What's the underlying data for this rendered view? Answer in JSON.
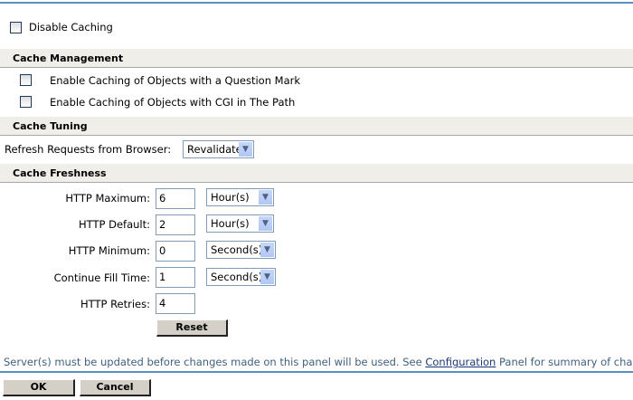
{
  "disable_caching": {
    "label": "Disable Caching",
    "checked": false
  },
  "cache_management": {
    "title": "Cache Management",
    "options": [
      {
        "label": "Enable Caching of Objects with a Question Mark",
        "checked": false
      },
      {
        "label": "Enable Caching of Objects with CGI in The Path",
        "checked": false
      }
    ]
  },
  "cache_tuning": {
    "title": "Cache Tuning",
    "refresh_label": "Refresh Requests from Browser:",
    "refresh_value": "Revalidate"
  },
  "cache_freshness": {
    "title": "Cache Freshness",
    "rows": [
      {
        "label": "HTTP Maximum:",
        "value": "6",
        "unit": "Hour(s)"
      },
      {
        "label": "HTTP Default:",
        "value": "2",
        "unit": "Hour(s)"
      },
      {
        "label": "HTTP Minimum:",
        "value": "0",
        "unit": "Second(s)"
      },
      {
        "label": "Continue Fill Time:",
        "value": "1",
        "unit": "Second(s)"
      },
      {
        "label": "HTTP Retries:",
        "value": "4"
      }
    ],
    "reset_label": "Reset"
  },
  "note": {
    "before": "Server(s) must be updated before changes made on this panel will be used. See ",
    "link": "Configuration",
    "after": " Panel for summary of changes."
  },
  "footer": {
    "ok": "OK",
    "cancel": "Cancel"
  },
  "colors": {
    "accent": "#5b8fbd",
    "section_bg": "#efeee9"
  }
}
